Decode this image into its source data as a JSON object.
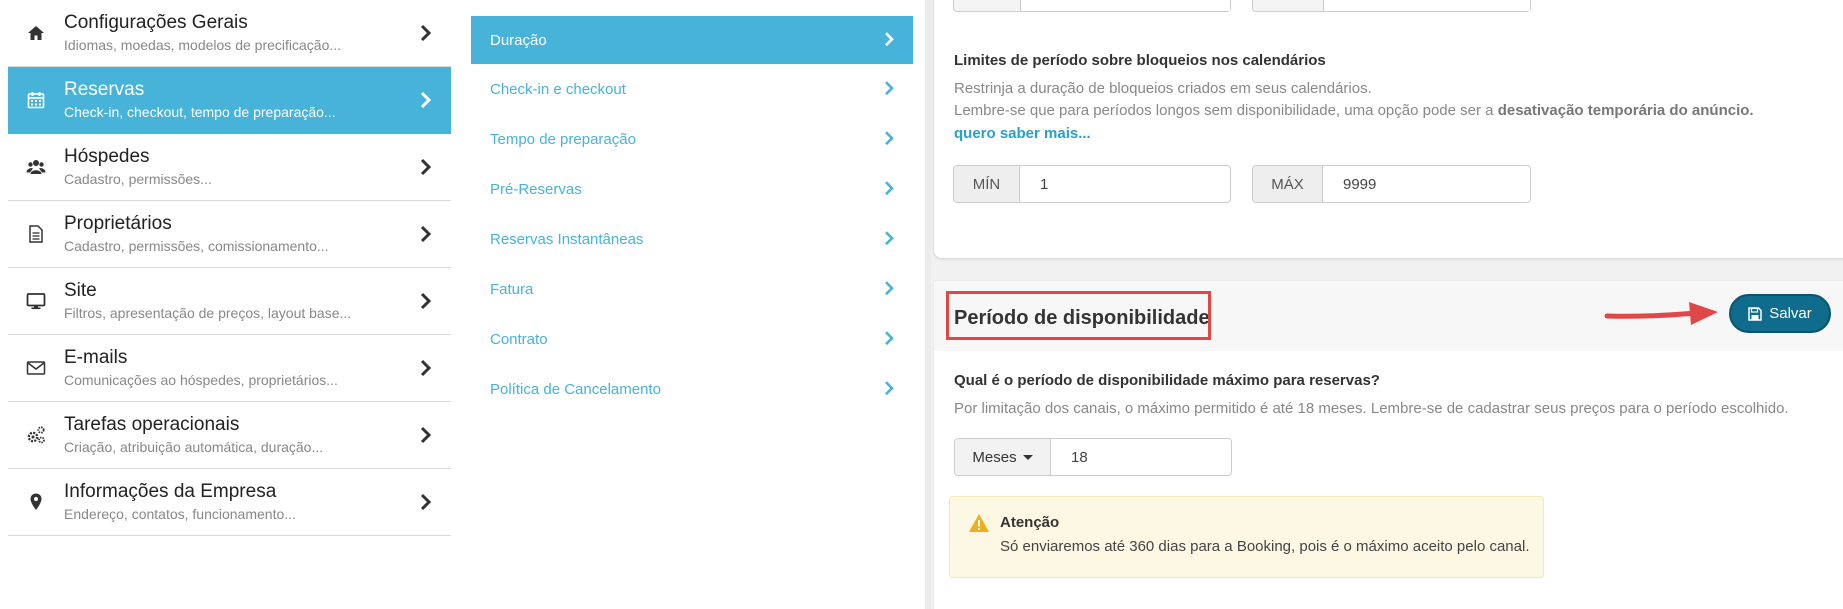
{
  "left_menu": [
    {
      "title": "Configurações Gerais",
      "subtitle": "Idiomas, moedas, modelos de precificação...",
      "icon": "home-icon",
      "active": false
    },
    {
      "title": "Reservas",
      "subtitle": "Check-in, checkout, tempo de preparação...",
      "icon": "calendar-icon",
      "active": true
    },
    {
      "title": "Hóspedes",
      "subtitle": "Cadastro, permissões...",
      "icon": "users-icon",
      "active": false
    },
    {
      "title": "Proprietários",
      "subtitle": "Cadastro, permissões, comissionamento...",
      "icon": "document-icon",
      "active": false
    },
    {
      "title": "Site",
      "subtitle": "Filtros, apresentação de preços, layout base...",
      "icon": "monitor-icon",
      "active": false
    },
    {
      "title": "E-mails",
      "subtitle": "Comunicações ao hóspedes, proprietários...",
      "icon": "envelope-icon",
      "active": false
    },
    {
      "title": "Tarefas operacionais",
      "subtitle": "Criação, atribuição automática, duração...",
      "icon": "gears-icon",
      "active": false
    },
    {
      "title": "Informações da Empresa",
      "subtitle": "Endereço, contatos, funcionamento...",
      "icon": "map-marker-icon",
      "active": false
    }
  ],
  "sub_menu": [
    {
      "label": "Duração",
      "active": true
    },
    {
      "label": "Check-in e checkout",
      "active": false
    },
    {
      "label": "Tempo de preparação",
      "active": false
    },
    {
      "label": "Pré-Reservas",
      "active": false
    },
    {
      "label": "Reservas Instantâneas",
      "active": false
    },
    {
      "label": "Fatura",
      "active": false
    },
    {
      "label": "Contrato",
      "active": false
    },
    {
      "label": "Política de Cancelamento",
      "active": false
    }
  ],
  "blocks_section": {
    "title": "Limites de período sobre bloqueios nos calendários",
    "desc1": "Restrinja a duração de bloqueios criados em seus calendários.",
    "desc2_prefix": "Lembre-se que para períodos longos sem disponibilidade, uma opção pode ser a ",
    "desc2_bold": "desativação temporária do anúncio.",
    "link": "quero saber mais...",
    "min_label": "MÍN",
    "min_value": "1",
    "max_label": "MÁX",
    "max_value": "9999"
  },
  "availability_section": {
    "title": "Período de disponibilidade",
    "save_label": "Salvar",
    "question": "Qual é o período de disponibilidade máximo para reservas?",
    "help": "Por limitação dos canais, o máximo permitido é até 18 meses. Lembre-se de cadastrar seus preços para o período escolhido.",
    "unit_label": "Meses",
    "value": "18",
    "alert_title": "Atenção",
    "alert_body": "Só enviaremos até 360 dias para a Booking, pois é o máximo aceito pelo canal."
  },
  "colors": {
    "accent": "#47b3d9",
    "save_button": "#0f6c8c",
    "annotation": "#e04848",
    "alert_bg": "#fcf8e3",
    "warning": "#f0ad1c"
  }
}
